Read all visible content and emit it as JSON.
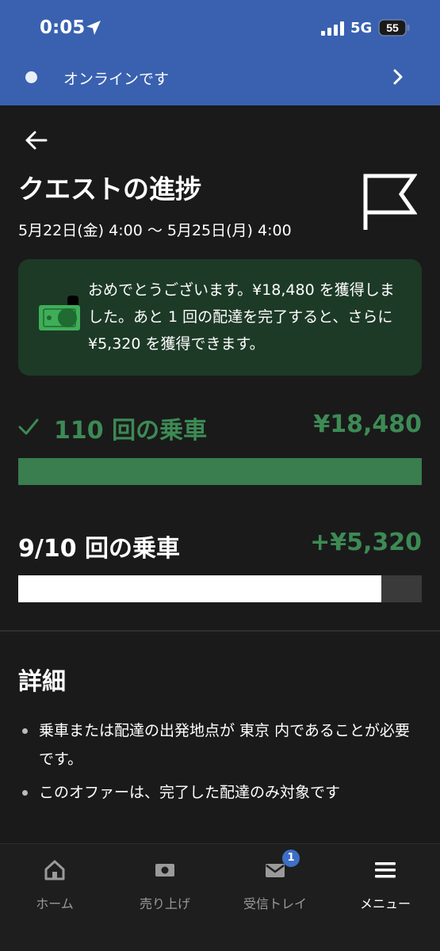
{
  "status_bar": {
    "time": "0:05",
    "network": "5G",
    "battery": "55",
    "icons": [
      "location-arrow-icon",
      "signal-icon",
      "battery-icon"
    ]
  },
  "online_banner": {
    "text": "オンラインです",
    "icon": "chevron-right-icon"
  },
  "header": {
    "title": "クエストの進捗",
    "date_range": "5月22日(金) 4:00 〜 5月25日(月) 4:00",
    "icons": [
      "back-arrow-icon",
      "flag-icon"
    ]
  },
  "congrats": {
    "text": "おめでとうございます。¥18,480 を獲得しました。あと 1 回の配達を完了すると、さらに ¥5,320 を獲得できます。",
    "icon": "money-icon"
  },
  "quests": [
    {
      "label": "110 回の乗車",
      "amount": "¥18,480",
      "progress": 1.0,
      "completed": true
    },
    {
      "label": "9/10 回の乗車",
      "amount": "+¥5,320",
      "progress": 0.9,
      "completed": false
    }
  ],
  "details": {
    "title": "詳細",
    "items": [
      "乗車または配達の出発地点が 東京 内であることが必要です。",
      "このオファーは、完了した配達のみ対象です"
    ]
  },
  "tabbar": {
    "tabs": [
      {
        "label": "ホーム",
        "icon": "home-icon"
      },
      {
        "label": "売り上げ",
        "icon": "earnings-icon"
      },
      {
        "label": "受信トレイ",
        "icon": "inbox-icon",
        "badge": "1"
      },
      {
        "label": "メニュー",
        "icon": "menu-icon",
        "active": true
      }
    ]
  },
  "colors": {
    "banner": "#3961b0",
    "background": "#1a1a1a",
    "success_green": "#3d8a55",
    "congrats_bg": "#1d3a27",
    "badge": "#3d6fc7"
  }
}
